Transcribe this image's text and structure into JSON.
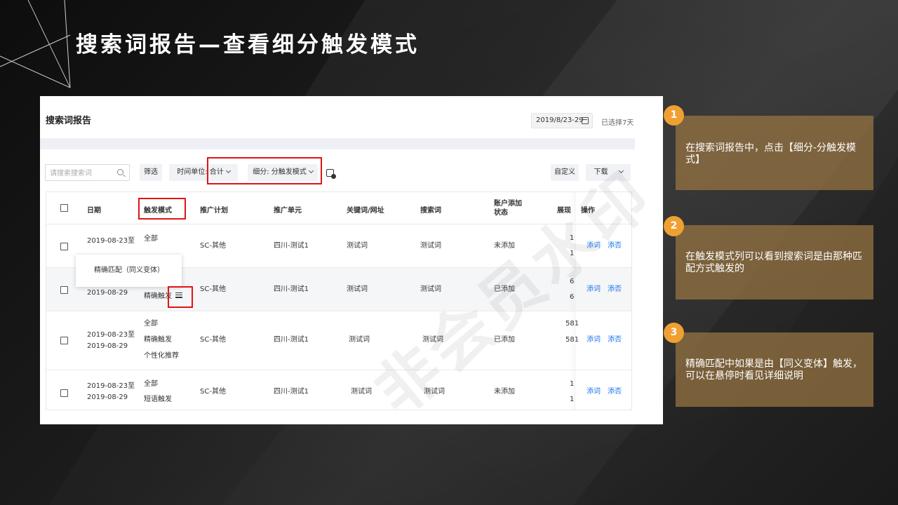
{
  "slide": {
    "title": "搜索词报告—查看细分触发模式"
  },
  "report": {
    "title": "搜索词报告",
    "date_range": "2019/8/23-29",
    "selected_days": "已选择7天",
    "search_placeholder": "请搜索搜索词",
    "filter_label": "筛选",
    "time_unit_label": "时间单位: 合计",
    "segment_label": "细分: 分触发模式",
    "custom_label": "自定义",
    "download_label": "下载",
    "tooltip_text": "精确匹配（同义变体）",
    "columns": {
      "date": "日期",
      "trigger_mode": "触发模式",
      "plan": "推广计划",
      "unit": "推广单元",
      "keyword_url": "关键词/网址",
      "search_term": "搜索词",
      "account_status": "账户添加状态",
      "impressions": "展现",
      "actions": "操作"
    },
    "rows": [
      {
        "date": "2019-08-23至",
        "trigger_lines": [
          "全部",
          ""
        ],
        "plan": "SC-其他",
        "unit": "四川-测试1",
        "keyword": "测试词",
        "search_term": "测试词",
        "status": "未添加",
        "impressions": [
          "1",
          "1"
        ],
        "add_word": "添词",
        "add_negative": "添否"
      },
      {
        "date": "2019-08-29",
        "trigger_lines": [
          "精确触发"
        ],
        "plan": "SC-其他",
        "unit": "四川-测试1",
        "keyword": "测试词",
        "search_term": "测试词",
        "status": "已添加",
        "impressions": [
          "6",
          "6"
        ],
        "add_word": "添词",
        "add_negative": "添否"
      },
      {
        "date": "2019-08-23至\n2019-08-29",
        "trigger_lines": [
          "全部",
          "精确触发",
          "个性化推荐"
        ],
        "plan": "SC-其他",
        "unit": "四川-测试1",
        "keyword": "测试词",
        "search_term": "测试词",
        "status": "已添加",
        "impressions": [
          "581",
          "581"
        ],
        "add_word": "添词",
        "add_negative": "添否"
      },
      {
        "date": "2019-08-23至\n2019-08-29",
        "trigger_lines": [
          "全部",
          "短语触发"
        ],
        "plan": "SC-其他",
        "unit": "四川-测试1",
        "keyword": "测试词",
        "search_term": "测试词",
        "status": "未添加",
        "impressions": [
          "1",
          "1"
        ],
        "add_word": "添词",
        "add_negative": "添否"
      }
    ]
  },
  "watermark": "非会员水印",
  "steps": [
    {
      "number": "1",
      "text": "在搜索词报告中，点击【细分-分触发模式】"
    },
    {
      "number": "2",
      "text": "在触发模式列可以看到搜索词是由那种匹配方式触发的"
    },
    {
      "number": "3",
      "text": "精确匹配中如果是由【同义变体】触发，可以在悬停时看见详细说明"
    }
  ],
  "colors": {
    "accent_orange": "#f0a032",
    "card_brown": "#96733f",
    "highlight_red": "#e01414",
    "link_blue": "#1a74e8"
  }
}
